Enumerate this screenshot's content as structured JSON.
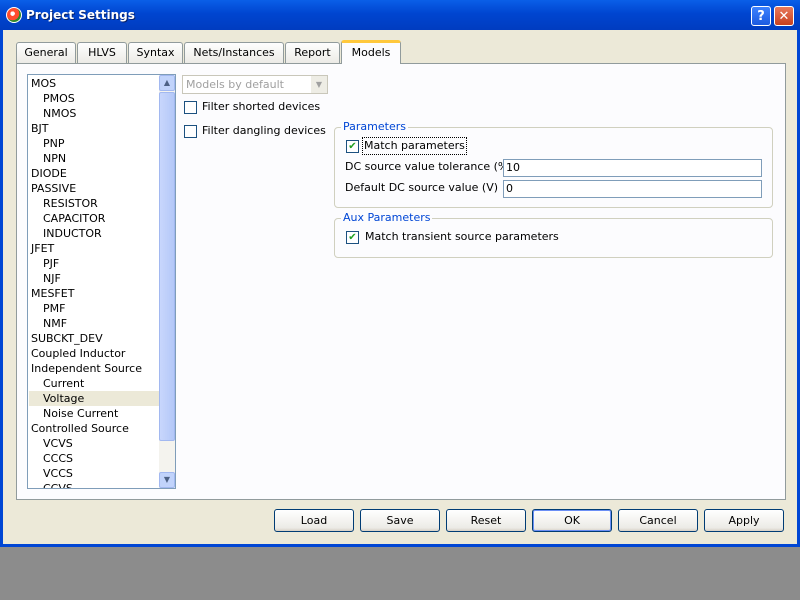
{
  "window": {
    "title": "Project Settings",
    "help_label": "?",
    "close_label": "✕",
    "icon": "app-logo-icon"
  },
  "tabs": [
    {
      "label": "General"
    },
    {
      "label": "HLVS"
    },
    {
      "label": "Syntax"
    },
    {
      "label": "Nets/Instances"
    },
    {
      "label": "Report"
    },
    {
      "label": "Models",
      "active": true
    }
  ],
  "device_list": {
    "items": [
      {
        "label": "MOS"
      },
      {
        "label": "PMOS"
      },
      {
        "label": "NMOS"
      },
      {
        "label": "BJT"
      },
      {
        "label": "PNP"
      },
      {
        "label": "NPN"
      },
      {
        "label": "DIODE"
      },
      {
        "label": "PASSIVE"
      },
      {
        "label": "RESISTOR"
      },
      {
        "label": "CAPACITOR"
      },
      {
        "label": "INDUCTOR"
      },
      {
        "label": "JFET"
      },
      {
        "label": "PJF"
      },
      {
        "label": "NJF"
      },
      {
        "label": "MESFET"
      },
      {
        "label": "PMF"
      },
      {
        "label": "NMF"
      },
      {
        "label": "SUBCKT_DEV"
      },
      {
        "label": "Coupled Inductor"
      },
      {
        "label": "Independent Source"
      },
      {
        "label": "Current"
      },
      {
        "label": "Voltage",
        "selected": true
      },
      {
        "label": "Noise Current"
      },
      {
        "label": "Controlled Source"
      },
      {
        "label": "VCVS"
      },
      {
        "label": "CCCS"
      },
      {
        "label": "VCCS"
      },
      {
        "label": "CCVS"
      }
    ]
  },
  "model_select": {
    "value": "Models by default"
  },
  "options": {
    "filter_shorted": {
      "label": "Filter shorted devices",
      "checked": false
    },
    "filter_dangling": {
      "label": "Filter dangling devices",
      "checked": false
    }
  },
  "parameters": {
    "title": "Parameters",
    "match_label": "Match parameters",
    "match_checked": true,
    "tolerance_label": "DC source value tolerance (%)",
    "tolerance_value": "10",
    "default_label": "Default DC source value (V)",
    "default_value": "0"
  },
  "aux": {
    "title": "Aux Parameters",
    "match_transient_label": "Match transient source parameters",
    "match_transient_checked": true
  },
  "buttons": {
    "load": "Load",
    "save": "Save",
    "reset": "Reset",
    "ok": "OK",
    "cancel": "Cancel",
    "apply": "Apply"
  },
  "check_glyph": "✔",
  "colors": {
    "titlebar": "#0054e3",
    "group_title": "#0046d5",
    "active_tab_accent": "#ffc83c"
  }
}
